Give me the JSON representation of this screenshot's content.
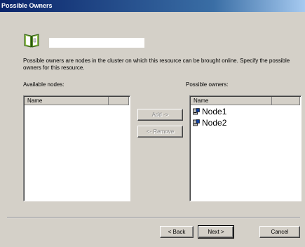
{
  "window": {
    "title": "Possible Owners"
  },
  "header": {
    "resource_name": ""
  },
  "description": "Possible owners are nodes in the cluster on which this resource can be brought online. Specify the possible owners for this resource.",
  "available": {
    "label": "Available nodes:",
    "column": "Name",
    "items": []
  },
  "owners": {
    "label": "Possible owners:",
    "column": "Name",
    "items": [
      {
        "label": "Node1",
        "icon": "server-node-icon"
      },
      {
        "label": "Node2",
        "icon": "server-node-icon"
      }
    ]
  },
  "buttons": {
    "add": "Add ->",
    "remove": "<- Remove",
    "back": "< Back",
    "next": "Next >",
    "cancel": "Cancel"
  },
  "colors": {
    "titlebar": "#0a246a",
    "dialog_bg": "#d4d0c8"
  }
}
